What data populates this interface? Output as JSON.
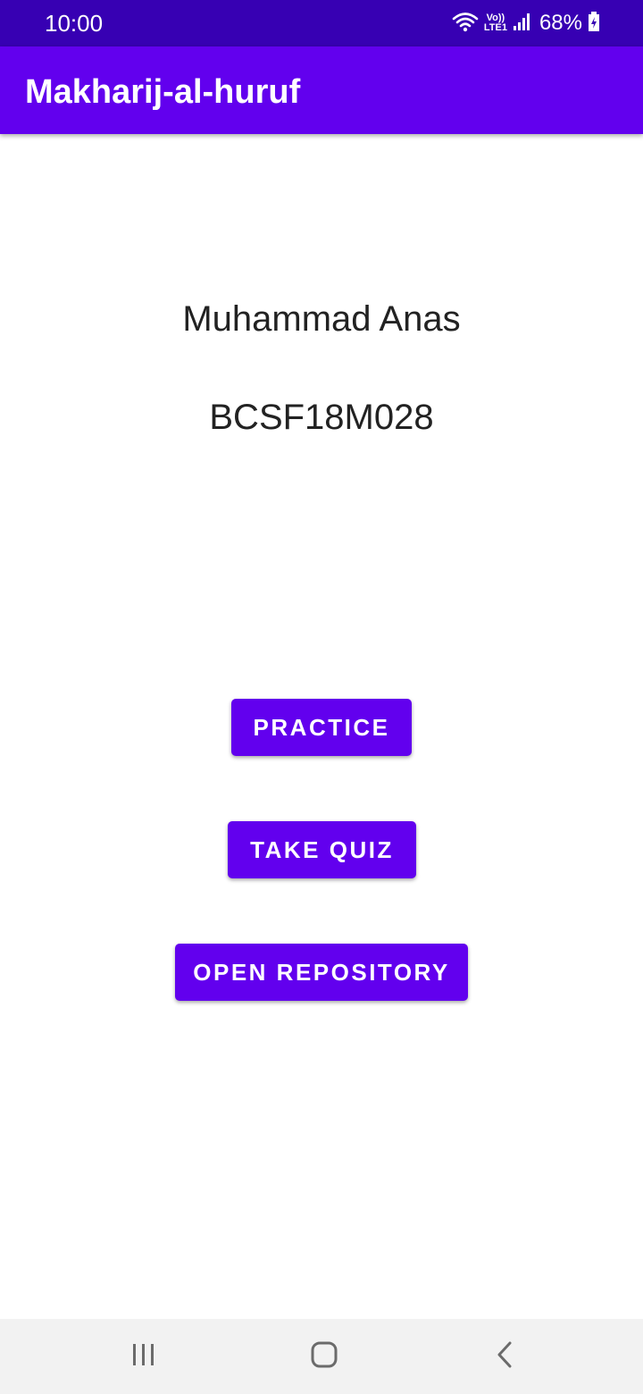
{
  "status_bar": {
    "time": "10:00",
    "network_label_top": "Vo))",
    "network_label_bottom": "LTE1",
    "battery": "68%",
    "icons": [
      "wifi-icon",
      "signal-icon",
      "battery-icon"
    ]
  },
  "app_bar": {
    "title": "Makharij-al-huruf"
  },
  "main": {
    "name": "Muhammad Anas",
    "roll_number": "BCSF18M028",
    "buttons": {
      "practice": "PRACTICE",
      "take_quiz": "TAKE QUIZ",
      "open_repository": "OPEN REPOSITORY"
    }
  },
  "nav_bar": {
    "icons": [
      "recents-icon",
      "home-icon",
      "back-icon"
    ]
  },
  "colors": {
    "status_bar": "#3700b3",
    "primary": "#6200ee",
    "background": "#ffffff",
    "nav_bar": "#f2f2f2"
  }
}
